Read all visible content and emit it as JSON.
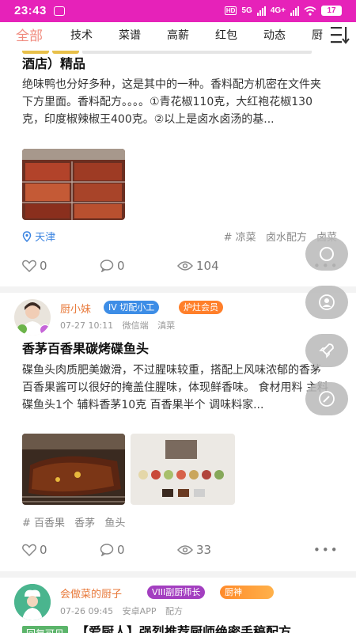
{
  "status": {
    "time": "23:43",
    "battery": "17",
    "net1": "HD",
    "net2": "5G",
    "net3": "4G+"
  },
  "tabs": [
    "全部",
    "技术",
    "菜谱",
    "高薪",
    "红包",
    "动态",
    "厨"
  ],
  "post1": {
    "title": "酒店）精品",
    "body": "绝味鸭也分好多种，这是其中的一种。香料配方机密在文件夹下方里面。香料配方。。。。①青花椒110克，大红袍花椒130克，印度椒辣椒王400克。②以上是卤水卤汤的基...",
    "location": "天津",
    "tags": [
      "# 凉菜",
      "卤水配方",
      "卤菜"
    ],
    "likes": "0",
    "comments": "0",
    "views": "104"
  },
  "post2": {
    "author": "厨小妹",
    "badge1": "IV 切配小工",
    "badge2": "炉灶会员",
    "time": "07-27 10:11",
    "source": "微信端",
    "category": "滇菜",
    "title": "香茅百香果碳烤碟鱼头",
    "body": "碟鱼头肉质肥美嫩滑，不过腥味较重，搭配上风味浓郁的香茅百香果酱可以很好的掩盖住腥味，体现鲜香味。 食材用料 主料碟鱼头1个 辅料香茅10克 百香果半个 调味料家...",
    "tags": [
      "# 百香果",
      "香茅",
      "鱼头"
    ],
    "likes": "0",
    "comments": "0",
    "views": "33"
  },
  "post3": {
    "author": "会做菜的厨子",
    "badge1": "VIII副厨师长",
    "badge2": "厨神",
    "time": "07-26 09:45",
    "source": "安卓APP",
    "category": "配方",
    "tag": "回复可见",
    "title": "【爱厨人】强烈推荐厨师绝密手稿配方"
  },
  "colors": {
    "accent": "#f08a7d",
    "statusbar": "#e622b9",
    "location": "#3a83e0",
    "name": "#e8793a"
  }
}
